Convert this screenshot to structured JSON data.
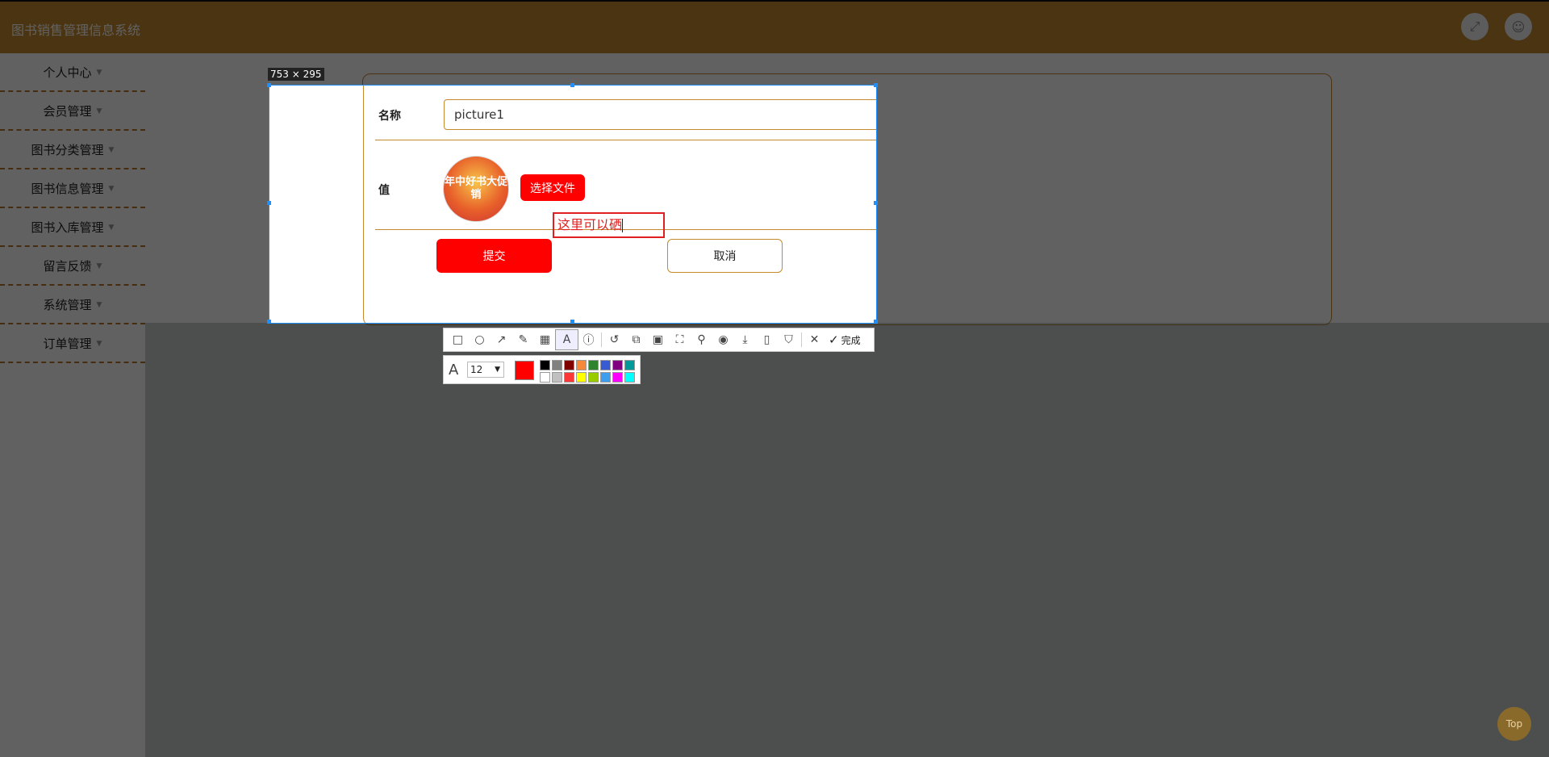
{
  "header": {
    "title": "图书销售管理信息系统",
    "fullscreen_icon": "expand-icon",
    "user_icon": "user-icon"
  },
  "sidebar": {
    "items": [
      {
        "label": "个人中心"
      },
      {
        "label": "会员管理"
      },
      {
        "label": "图书分类管理"
      },
      {
        "label": "图书信息管理"
      },
      {
        "label": "图书入库管理"
      },
      {
        "label": "留言反馈"
      },
      {
        "label": "系统管理"
      },
      {
        "label": "订单管理"
      }
    ]
  },
  "form": {
    "name_label": "名称",
    "name_value": "picture1",
    "value_label": "值",
    "thumbnail_text": "年中好书大促销",
    "choose_file": "选择文件",
    "submit": "提交",
    "cancel": "取消"
  },
  "screenshot_tool": {
    "size_label": "753 × 295",
    "annotation_text": "这里可以硒",
    "done_label": "完成",
    "font_size": "12",
    "current_color": "#ff0000",
    "palette": [
      "#000000",
      "#808080",
      "#800000",
      "#f7883a",
      "#308430",
      "#385ad3",
      "#800080",
      "#009999",
      "#ffffff",
      "#c0c0c0",
      "#fb3838",
      "#ffff00",
      "#99cc00",
      "#3d9ef0",
      "#fb00fb",
      "#00ffff"
    ]
  },
  "top_button": "Top",
  "colors": {
    "brand": "#c58a2f",
    "danger": "#ff0000",
    "selection": "#1e90ff"
  }
}
